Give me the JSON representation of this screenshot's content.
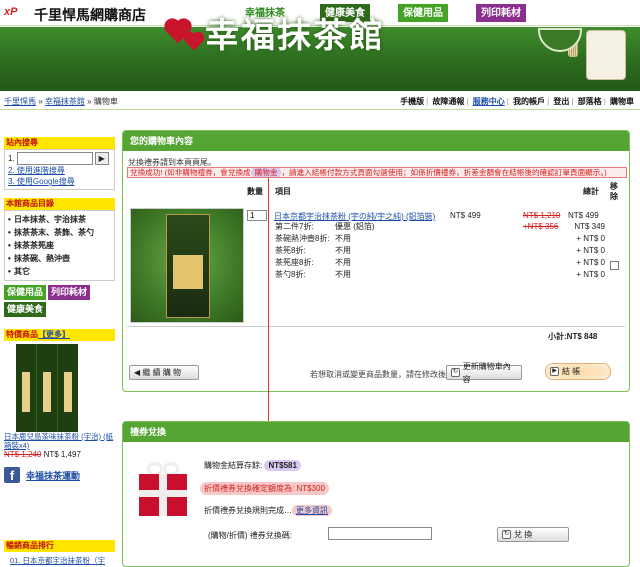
{
  "top": {
    "logo_mark": "xP",
    "site_name": "千里悍馬網購商店",
    "tabs": [
      "幸福抹茶",
      "健康美食",
      "保健用品",
      "列印耗材"
    ]
  },
  "banner": {
    "title": "幸福抹茶館"
  },
  "breadcrumb": {
    "items": [
      "千里悍馬",
      "幸福抹茶館",
      "購物車"
    ],
    "sep": "»"
  },
  "account_nav": [
    "手機版",
    "故障通報",
    "服務中心",
    "我的帳戶",
    "登出",
    "部落格",
    "購物車"
  ],
  "sidebar": {
    "search": {
      "title": "站內搜尋",
      "prefix1": "1.",
      "button": "▶",
      "link2": "2. 使用進階搜尋",
      "link3": "3. 使用Google搜尋"
    },
    "categories": {
      "title": "本館商品目錄",
      "items": [
        "日本抹茶、宇治抹茶",
        "抹茶茶末、茶飾、茶勺",
        "抹茶茶筅座",
        "抹茶碗、熱沖壺",
        "其它"
      ]
    },
    "tags": [
      "保健用品",
      "列印耗材",
      "健康美食"
    ],
    "special": {
      "title": "特價商品",
      "more": "【更多】",
      "name": "日本鹿兒島茶味抹茶粉 (宇治) (紙箱裝x4)",
      "orig": "NT$ 1,240",
      "price": "NT$ 1,497"
    },
    "facebook": {
      "icon": "f",
      "text": "幸福抹茶運動"
    },
    "bestsellers": {
      "title": "暢銷商品排行",
      "item1": "01. 日本京都宇治抹茶粉（宇"
    }
  },
  "cart": {
    "title": "您的購物車內容",
    "notice1": "兌換禮券請到本頁頁尾。",
    "notice2_pre": "兌換成功! (如非購物禮券，會兌換成",
    "notice2_hl": "購物金",
    "notice2_post": "，請進入結帳付款方式頁面勾選使用；如係折價禮券，折差金額會在結帳後的確認訂單頁面顯示。)",
    "headers": {
      "qty": "數量",
      "item": "項目",
      "total": "總計",
      "remove": "移除"
    },
    "product": {
      "qty": "1",
      "name": "日本京都宇治抹茶粉 (宇の純/宇之純) (鋁箔裝)",
      "price": "NT$ 499",
      "orig_total": "NT$ 1,210",
      "final_total": "NT$ 499",
      "options": [
        {
          "k": "第二件7折:",
          "v": "優惠 (鋁箔)",
          "orig": "+NT$ 356",
          "p": "NT$ 349"
        },
        {
          "k": "茶碗熱沖壺8折:",
          "v": "不用",
          "orig": "",
          "p": "+ NT$ 0"
        },
        {
          "k": "茶筅8折:",
          "v": "不用",
          "orig": "",
          "p": "+ NT$ 0"
        },
        {
          "k": "茶筅座8折:",
          "v": "不用",
          "orig": "",
          "p": "+ NT$ 0"
        },
        {
          "k": "茶勺8折:",
          "v": "不用",
          "orig": "",
          "p": "+ NT$ 0"
        }
      ]
    },
    "subtotal": "小計:NT$ 848",
    "continue_btn": "◀  繼 續 購 物",
    "update_note": "若想取消或變更商品數量，請在修改後按",
    "update_btn": "更新購物車內容",
    "checkout_btn": "結 帳"
  },
  "gift": {
    "title": "禮券兌換",
    "points_label": "購物金結算存餘: ",
    "points_value": "NT$581",
    "discount_label": "折價禮券兌換確定額度為: NT$300",
    "rule_label": "折價禮券兌換規則完成…",
    "rule_more": "更多資訊",
    "code_label": "(購物/折價) 禮券兌換碼:",
    "code_value": "",
    "redeem_btn": "兌 換"
  },
  "colors": {
    "accent_green": "#54a534",
    "dark_green": "#2f6a1a",
    "purple": "#8a2f8e",
    "alert_red": "#d61f1f",
    "side_head_yellow": "#ffe600"
  }
}
